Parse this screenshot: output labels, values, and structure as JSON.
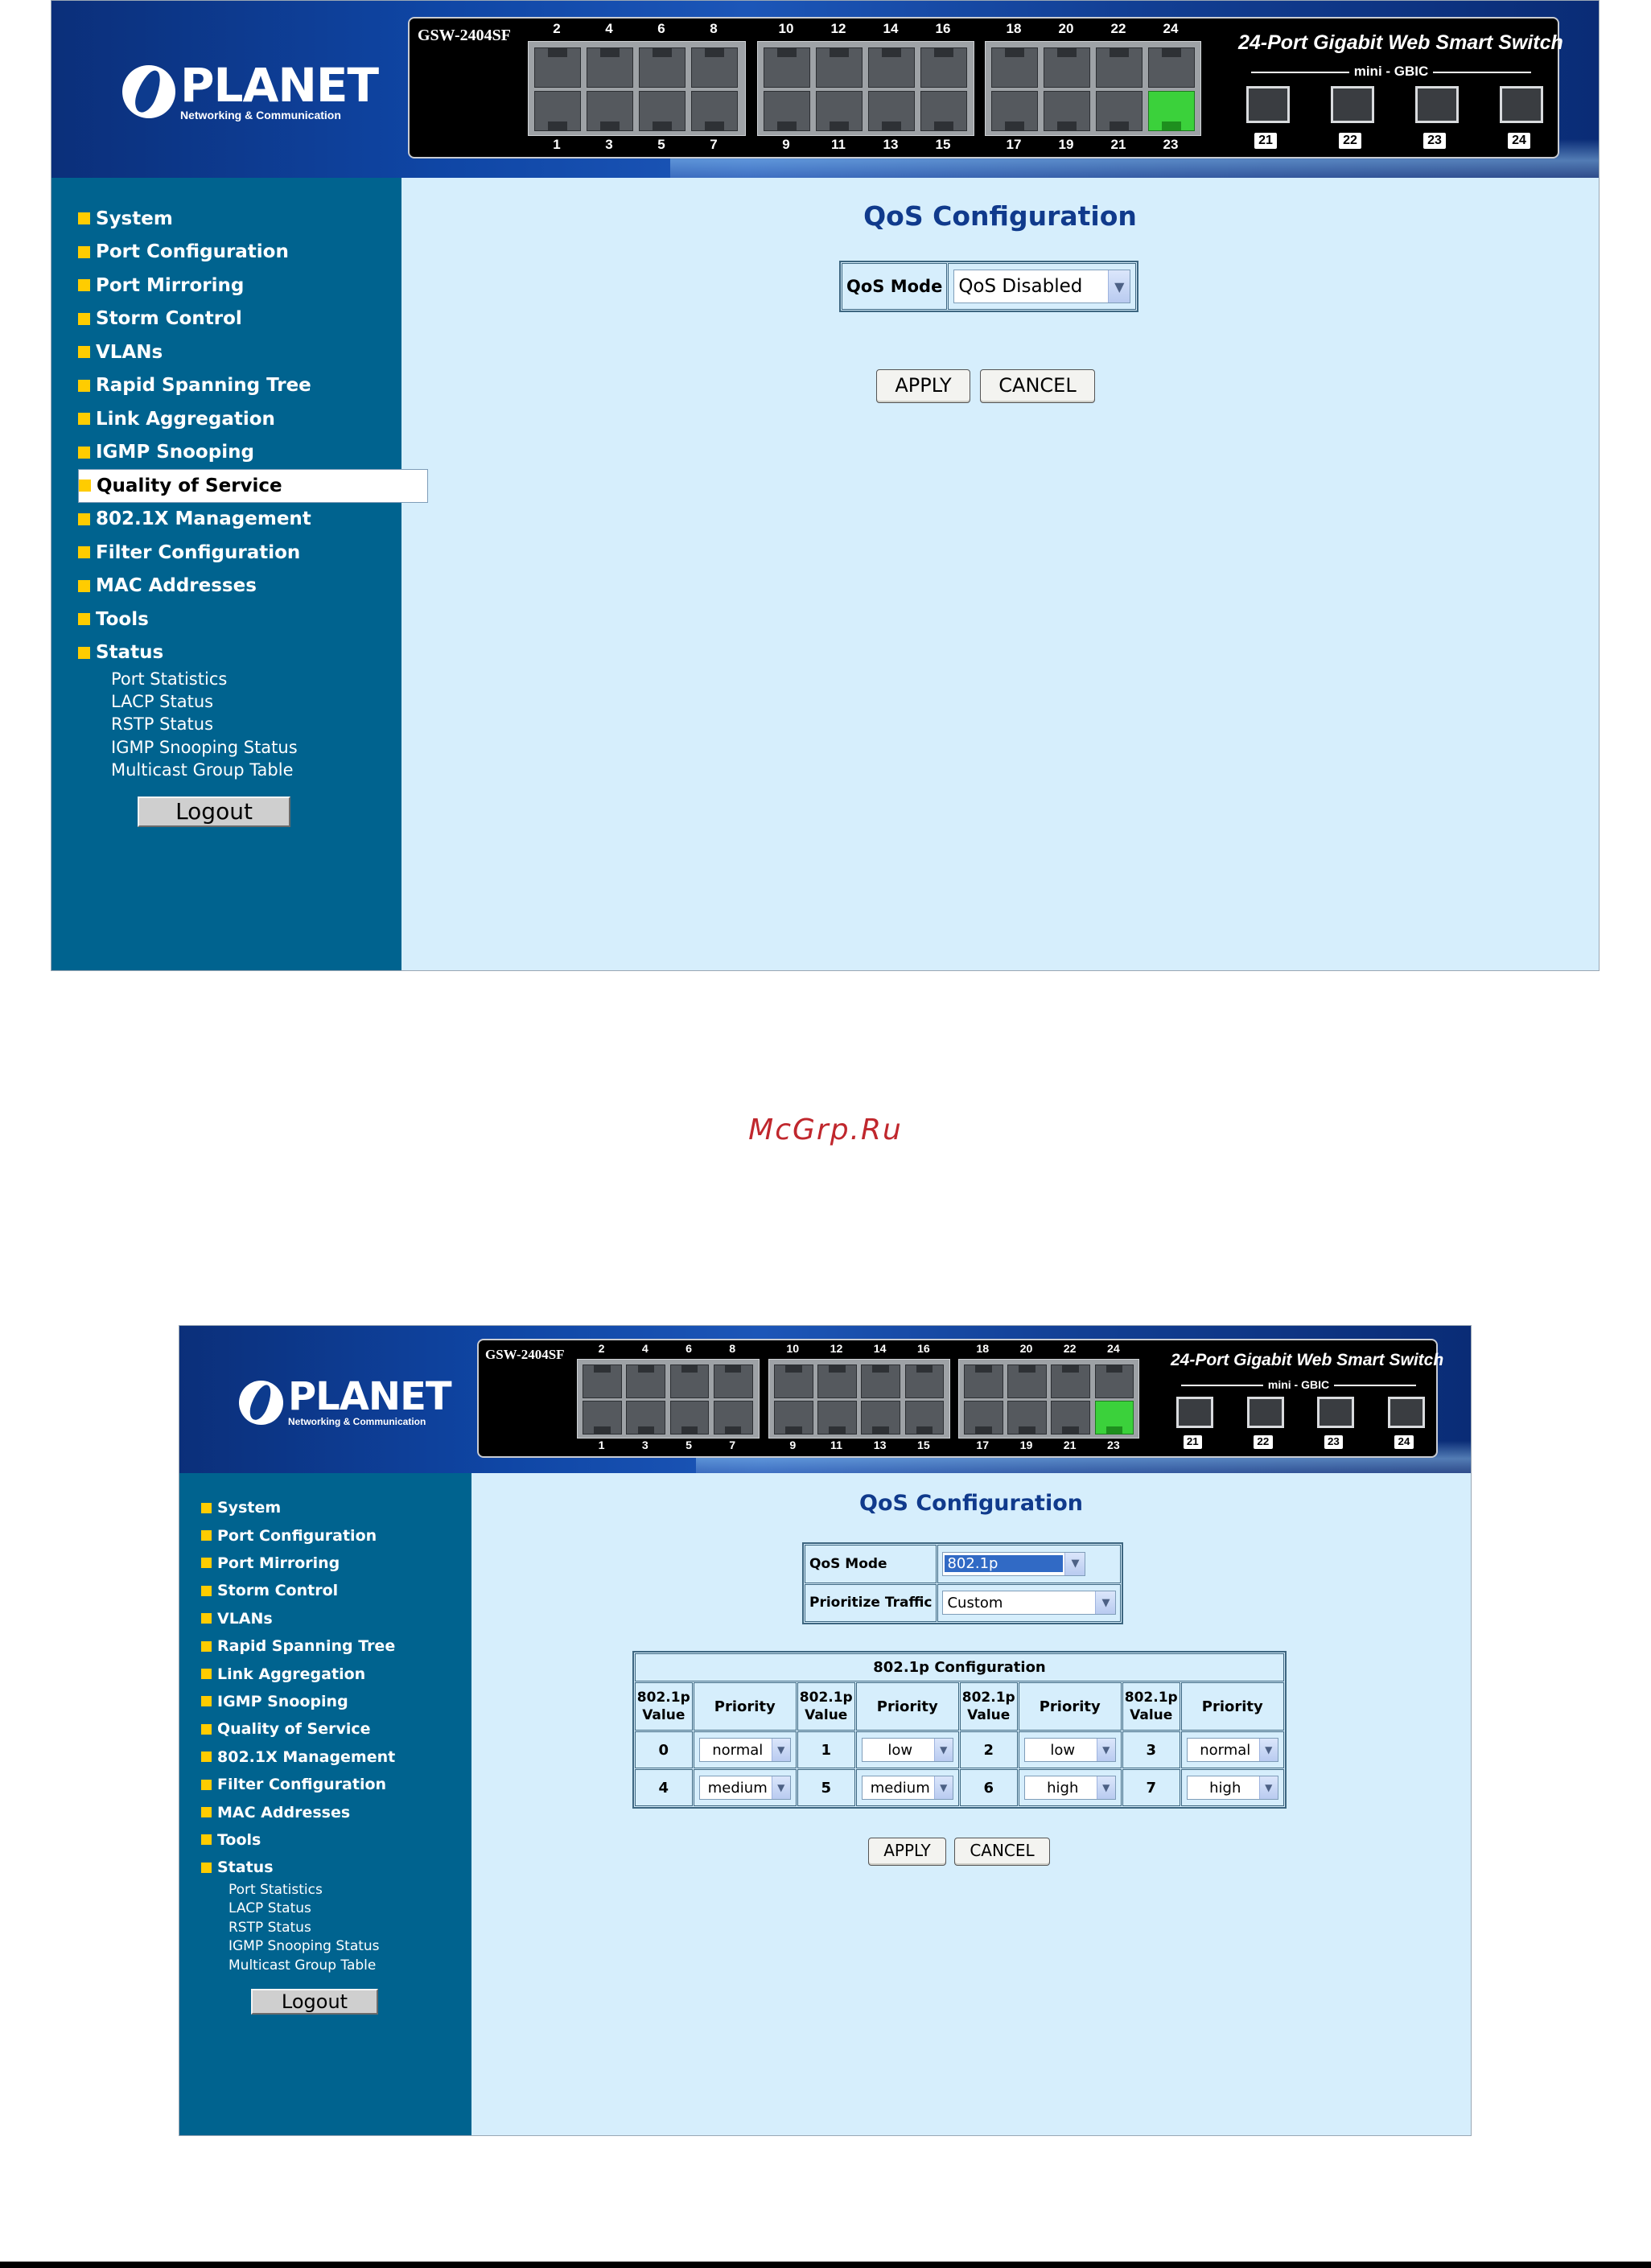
{
  "brand": {
    "name": "PLANET",
    "tagline": "Networking & Communication"
  },
  "device": {
    "model": "GSW-2404SF",
    "title": "24-Port Gigabit Web Smart Switch",
    "gbic_label": "mini - GBIC",
    "ports_top": [
      "2",
      "4",
      "6",
      "8",
      "10",
      "12",
      "14",
      "16",
      "18",
      "20",
      "22",
      "24"
    ],
    "ports_bottom": [
      "1",
      "3",
      "5",
      "7",
      "9",
      "11",
      "13",
      "15",
      "17",
      "19",
      "21",
      "23"
    ],
    "gbic_ports": [
      "21",
      "22",
      "23",
      "24"
    ]
  },
  "menu": {
    "items": [
      "System",
      "Port Configuration",
      "Port Mirroring",
      "Storm Control",
      "VLANs",
      "Rapid Spanning Tree",
      "Link Aggregation",
      "IGMP Snooping",
      "Quality of Service",
      "802.1X Management",
      "Filter Configuration",
      "MAC Addresses",
      "Tools",
      "Status"
    ],
    "status_sub": [
      "Port Statistics",
      "LACP Status",
      "RSTP Status",
      "IGMP Snooping Status",
      "Multicast Group Table"
    ],
    "logout": "Logout"
  },
  "qos": {
    "title": "QoS Configuration",
    "mode_label": "QoS Mode",
    "prioritize_label": "Prioritize Traffic",
    "apply": "APPLY",
    "cancel": "CANCEL"
  },
  "screen1": {
    "mode_value": "QoS Disabled"
  },
  "screen2": {
    "mode_value": "802.1p",
    "prioritize_value": "Custom",
    "table_title": "802.1p Configuration",
    "col_value": "802.1p Value",
    "col_priority": "Priority",
    "rows": [
      [
        {
          "value": "0",
          "priority": "normal"
        },
        {
          "value": "1",
          "priority": "low"
        },
        {
          "value": "2",
          "priority": "low"
        },
        {
          "value": "3",
          "priority": "normal"
        }
      ],
      [
        {
          "value": "4",
          "priority": "medium"
        },
        {
          "value": "5",
          "priority": "medium"
        },
        {
          "value": "6",
          "priority": "high"
        },
        {
          "value": "7",
          "priority": "high"
        }
      ]
    ]
  },
  "watermark": "McGrp.Ru",
  "colors": {
    "sidebar": "#00638f",
    "content": "#d6eefc",
    "title": "#103a8c",
    "bullet": "#ffcc00",
    "active_port": "#3bd13b"
  }
}
